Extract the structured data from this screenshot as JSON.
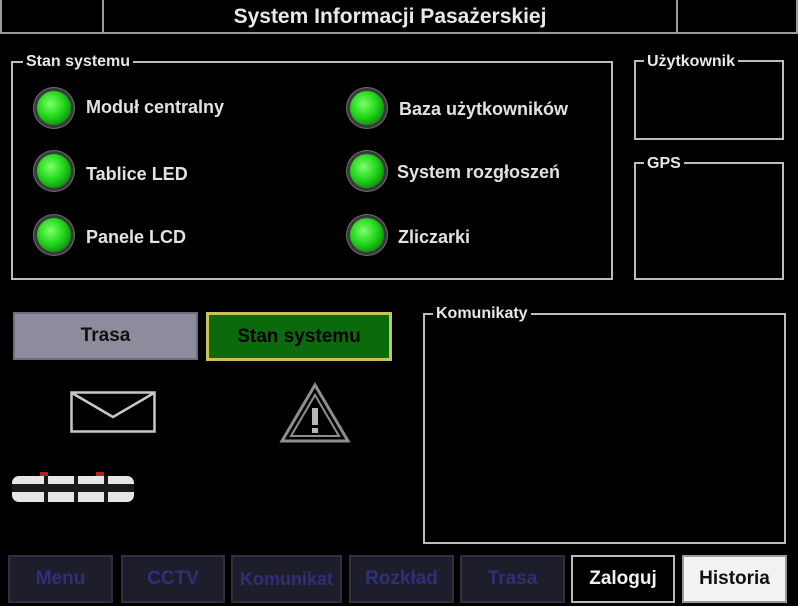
{
  "window": {
    "title": "System Informacji Pasażerskiej"
  },
  "status_panel": {
    "legend": "Stan systemu",
    "items": [
      {
        "label": "Moduł centralny",
        "state": "ok",
        "color": "#22d61a"
      },
      {
        "label": "Tablice LED",
        "state": "ok",
        "color": "#22d61a"
      },
      {
        "label": "Panele LCD",
        "state": "ok",
        "color": "#22d61a"
      },
      {
        "label": "Baza użytkowników",
        "state": "ok",
        "color": "#22d61a"
      },
      {
        "label": "System rozgłoszeń",
        "state": "ok",
        "color": "#22d61a"
      },
      {
        "label": "Zliczarki",
        "state": "ok",
        "color": "#22d61a"
      }
    ]
  },
  "user_panel": {
    "legend": "Użytkownik"
  },
  "gps_panel": {
    "legend": "GPS"
  },
  "messages_panel": {
    "legend": "Komunikaty"
  },
  "view_tabs": {
    "trasa": "Trasa",
    "stan_systemu": "Stan systemu"
  },
  "icons": {
    "message": "envelope-icon",
    "warning": "warning-triangle-icon",
    "vehicle": "train-icon"
  },
  "bottom_bar": {
    "items": [
      {
        "label": "Menu",
        "enabled": false
      },
      {
        "label": "CCTV",
        "enabled": false
      },
      {
        "label": "Komunikat",
        "enabled": false
      },
      {
        "label": "Rozkład",
        "enabled": false
      },
      {
        "label": "Trasa",
        "enabled": false
      },
      {
        "label": "Zaloguj",
        "enabled": true
      },
      {
        "label": "Historia",
        "enabled": true
      }
    ]
  },
  "colors": {
    "background": "#000000",
    "led_ok": "#22d61a",
    "active_tab": "#0b6a0b",
    "active_tab_border": "#c9c45a",
    "inactive_tab": "#8c8c9c",
    "frame": "#bdbdbd"
  }
}
